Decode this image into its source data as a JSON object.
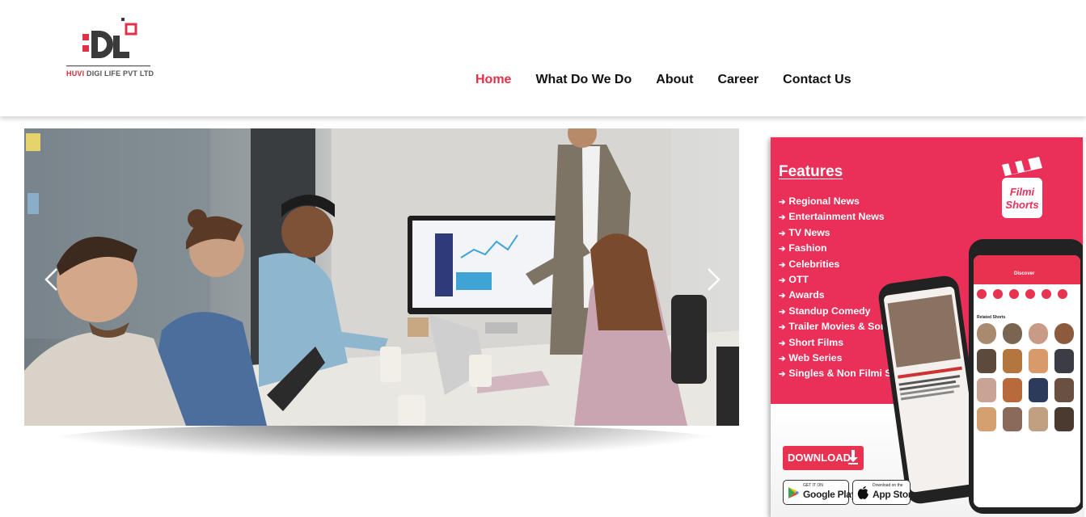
{
  "brand": {
    "logo_letters": "DL",
    "company_prefix": "HUVI",
    "company_rest": " DIGI LIFE PVT LTD"
  },
  "nav": {
    "items": [
      {
        "label": "Home",
        "active": true
      },
      {
        "label": "What Do We Do",
        "active": false
      },
      {
        "label": "About",
        "active": false
      },
      {
        "label": "Career",
        "active": false
      },
      {
        "label": "Contact Us",
        "active": false
      }
    ]
  },
  "promo": {
    "features_title": "Features",
    "features": [
      "Regional News",
      "Entertainment News",
      "TV News",
      "Fashion",
      "Celebrities",
      "OTT",
      "Awards",
      "Standup Comedy",
      "Trailer Movies & Songs",
      "Short Films",
      "Web Series",
      "Singles & Non Filmi Songs"
    ],
    "app_name_line1": "Filmi",
    "app_name_line2": "Shorts",
    "download_label": "DOWNLOAD",
    "google_play_small": "GET IT ON",
    "google_play_big": "Google Play",
    "app_store_small": "Download on the",
    "app_store_big": "App Store",
    "phone_screen_title": "Discover",
    "phone_section": "Related Shorts"
  },
  "colors": {
    "accent": "#e0314b",
    "promo_bg": "#ea2f58"
  }
}
